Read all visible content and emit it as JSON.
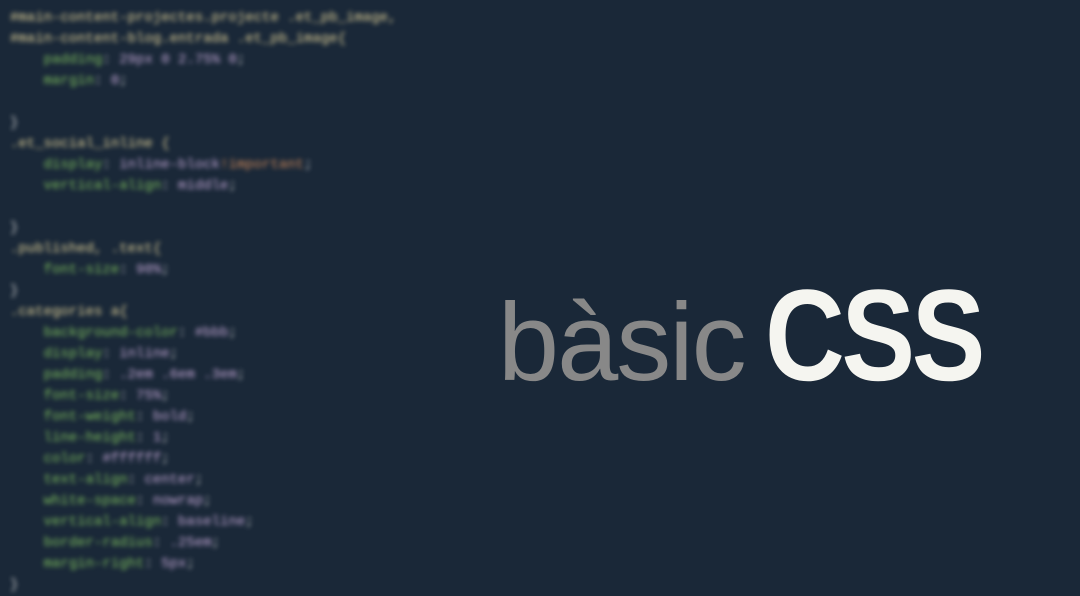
{
  "title": {
    "word1": "bàsic",
    "word2": "CSS"
  },
  "css_code": {
    "selector1": "#main-content-projectes.projecte .et_pb_image,",
    "selector2": "#main-content-blog.entrada .et_pb_image{",
    "rule1_prop1": "padding",
    "rule1_val1": "29px 0 2.75% 0",
    "rule1_prop2": "margin",
    "rule1_val2": "0",
    "brace_close": "}",
    "selector3": ".et_social_inline {",
    "rule2_prop1": "display",
    "rule2_val1": "inline-block",
    "rule2_imp": "!important",
    "rule2_prop2": "vertical-align",
    "rule2_val2": "middle",
    "selector4": ".published, .text{",
    "rule3_prop1": "font-size",
    "rule3_val1": "90%",
    "selector5": ".categories a{",
    "rule4_prop1": "background-color",
    "rule4_val1": "#bbb",
    "rule4_prop2": "display",
    "rule4_val2": "inline",
    "rule4_prop3": "padding",
    "rule4_val3": ".2em .6em .3em",
    "rule4_prop4": "font-size",
    "rule4_val4": "75%",
    "rule4_prop5": "font-weight",
    "rule4_val5": "bold",
    "rule4_prop6": "line-height",
    "rule4_val6": "1",
    "rule4_prop7": "color",
    "rule4_val7": "#ffffff",
    "rule4_prop8": "text-align",
    "rule4_val8": "center",
    "rule4_prop9": "white-space",
    "rule4_val9": "nowrap",
    "rule4_prop10": "vertical-align",
    "rule4_val10": "baseline",
    "rule4_prop11": "border-radius",
    "rule4_val11": ".25em",
    "rule4_prop12": "margin-right",
    "rule4_val12": "5px"
  },
  "colors": {
    "background": "#1a2838",
    "title_basic": "#888888",
    "title_css": "#f5f5f0",
    "code_selector": "#e4d49a",
    "code_property": "#7fbf5e",
    "code_value": "#c4a8d6"
  }
}
